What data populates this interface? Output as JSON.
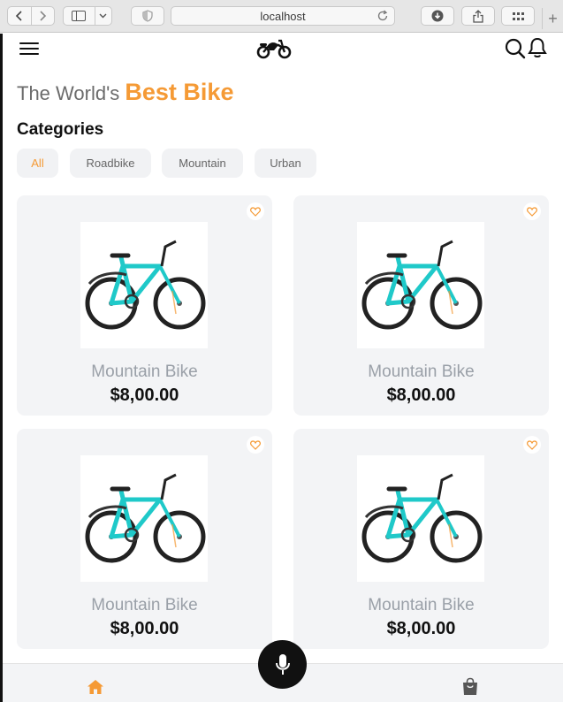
{
  "browser": {
    "address": "localhost",
    "icons": [
      "back-icon",
      "forward-icon",
      "sidebar-icon",
      "chevron-down-icon",
      "shield-icon",
      "reload-icon",
      "download-icon",
      "share-icon",
      "tabs-grid-icon",
      "new-tab-icon"
    ],
    "new_tab_glyph": "+"
  },
  "header": {
    "icons": [
      "menu-icon",
      "motorbike-logo-icon",
      "search-icon",
      "bell-icon"
    ]
  },
  "hero": {
    "prefix": "The World's",
    "accent": "Best Bike",
    "accent_color": "#f59a35"
  },
  "categories": {
    "title": "Categories",
    "items": [
      "All",
      "Roadbike",
      "Mountain",
      "Urban"
    ],
    "selected": "All"
  },
  "products": [
    {
      "name": "Mountain Bike",
      "price": "$8,00.00"
    },
    {
      "name": "Mountain Bike",
      "price": "$8,00.00"
    },
    {
      "name": "Mountain Bike",
      "price": "$8,00.00"
    },
    {
      "name": "Mountain Bike",
      "price": "$8,00.00"
    }
  ],
  "bottom_nav": {
    "icons": [
      "home-icon",
      "microphone-icon",
      "shopping-bag-icon"
    ],
    "active_color": "#f59a35"
  }
}
